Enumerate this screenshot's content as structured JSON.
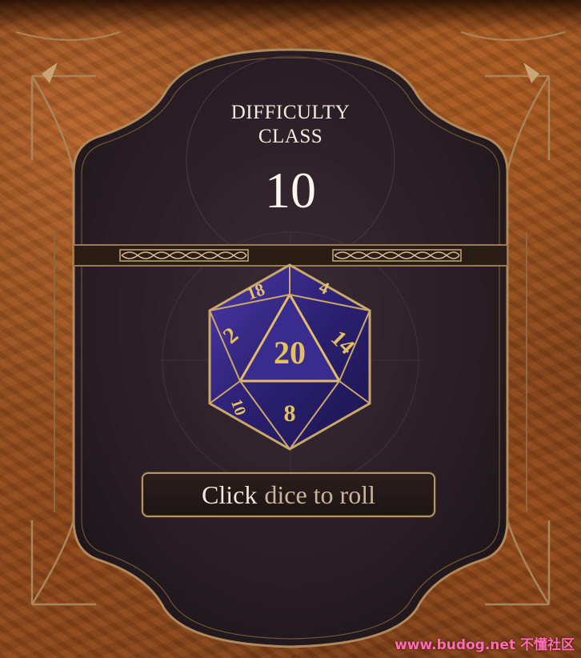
{
  "difficulty": {
    "label_line1": "DIFFICULTY",
    "label_line2": "CLASS",
    "value": "10"
  },
  "dice": {
    "type": "d20",
    "faces": {
      "center": "20",
      "top_left": "18",
      "top_right": "4",
      "left": "2",
      "right": "14",
      "bottom": "8",
      "bottom_left": "10"
    },
    "body_color": "#3a2a8c",
    "numeral_color": "#e5c063"
  },
  "roll_button": {
    "word1": "Click",
    "word2": "dice to roll"
  },
  "colors": {
    "frame_gold": "#b08a5c",
    "panel": "#2a1e22",
    "rock": "#9c5522"
  },
  "watermark": "www.budog.net 不懂社区"
}
